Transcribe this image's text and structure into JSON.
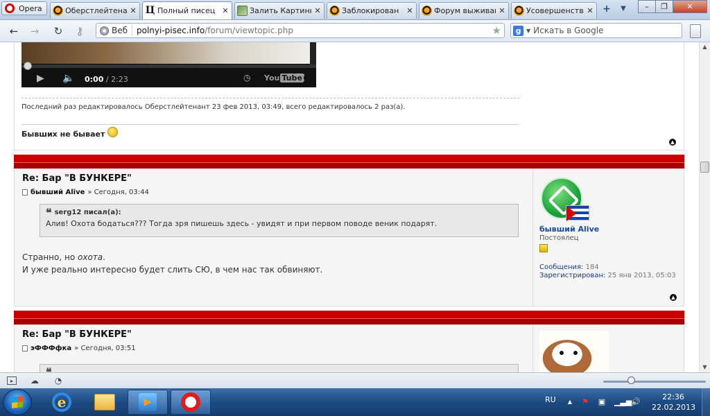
{
  "browser": {
    "menu_label": "Opera",
    "tabs": [
      {
        "title": "Оберстлейтенант",
        "icon": "forum-favicon"
      },
      {
        "title": "Полный писец",
        "icon": "pp-favicon",
        "active": true
      },
      {
        "title": "Залить Картинку",
        "icon": "image-favicon"
      },
      {
        "title": "Заблокирован",
        "icon": "forum-favicon"
      },
      {
        "title": "Форум выживание",
        "icon": "forum-favicon"
      },
      {
        "title": "Усовершенствование",
        "icon": "forum-favicon"
      }
    ],
    "web_chip": "Веб",
    "url_host": "polnyi-pisec.info",
    "url_path": "/forum/viewtopic.php",
    "search_placeholder": "Искать в Google"
  },
  "video": {
    "time_current": "0:00",
    "time_total": "/ 2:23",
    "brand": "You",
    "brand_tube": "Tube"
  },
  "post1": {
    "edit_note": "Последний раз редактировалось Оберстлейтенант 23 фев 2013, 03:49, всего редактировалось 2 раз(а).",
    "signature": "Бывших не бывает"
  },
  "post2": {
    "title": "Re: Бар \"В БУНКЕРЕ\"",
    "author": "бывший Alive",
    "time": "» Сегодня, 03:44",
    "quote_author": "serg12 писал(а):",
    "quote_text": "Алив! Охота бодаться??? Тогда зря пишешь здесь - увидят и при первом поводе веник подарят.",
    "body_line1_prefix": "Странно, но ",
    "body_line1_italic": "охота",
    "body_line1_suffix": ".",
    "body_line2": "И уже реально интересно будет слить СЮ, в чем нас так обвиняют.",
    "profile": {
      "name": "бывший Alive",
      "rank": "Постоялец",
      "posts_label": "Сообщения:",
      "posts": "184",
      "registered_label": "Зарегистрирован:",
      "registered": "25 янв 2013, 05:03"
    }
  },
  "post3": {
    "title": "Re: Бар \"В БУНКЕРЕ\"",
    "author": "эФФФфка",
    "time": "» Сегодня, 03:51"
  },
  "taskbar": {
    "lang": "RU",
    "time": "22:36",
    "date": "22.02.2013"
  },
  "colors": {
    "accent_red": "#c80000",
    "profile_link": "#1a4aa0"
  }
}
